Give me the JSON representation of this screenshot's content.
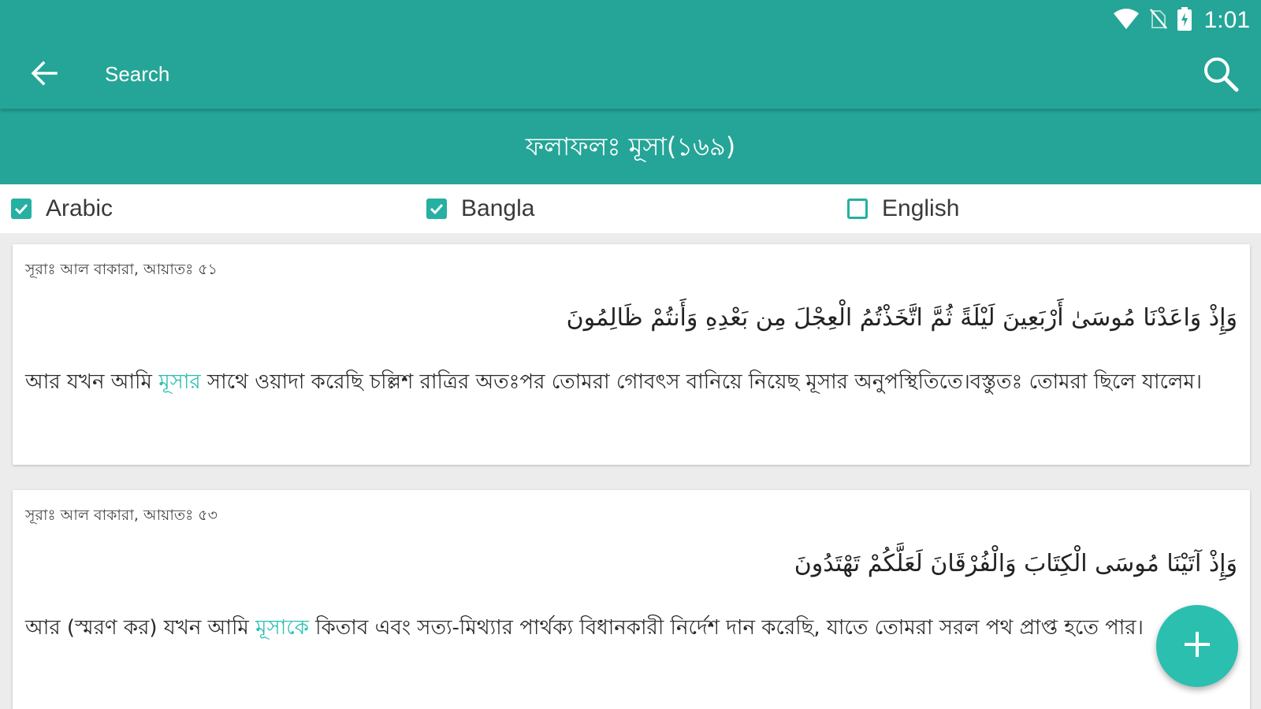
{
  "status_bar": {
    "time": "1:01",
    "icons": [
      "wifi-icon",
      "no-sim-icon",
      "battery-charging-icon"
    ]
  },
  "toolbar": {
    "back_icon": "arrow-left-icon",
    "title": "Search",
    "search_icon": "search-icon"
  },
  "results": {
    "title": "ফলাফলঃ মূসা(১৬৯)"
  },
  "filters": [
    {
      "label": "Arabic",
      "checked": true
    },
    {
      "label": "Bangla",
      "checked": true
    },
    {
      "label": "English",
      "checked": false
    }
  ],
  "cards": [
    {
      "reference": "সূরাঃ আল বাকারা, আয়াতঃ ৫১",
      "arabic": "وَإِذْ وَاعَدْنَا مُوسَىٰ أَرْبَعِينَ لَيْلَةً ثُمَّ اتَّخَذْتُمُ الْعِجْلَ مِن بَعْدِهِ وَأَنتُمْ ظَالِمُونَ",
      "bangla_before": "আর যখন আমি ",
      "bangla_highlight": "মূসার",
      "bangla_after": " সাথে ওয়াদা করেছি চল্লিশ রাত্রির অতঃপর তোমরা গোবৎস বানিয়ে নিয়েছ মূসার অনুপস্থিতিতে।বস্তুতঃ তোমরা ছিলে যালেম।"
    },
    {
      "reference": "সূরাঃ আল বাকারা, আয়াতঃ ৫৩",
      "arabic": "وَإِذْ آتَيْنَا مُوسَى الْكِتَابَ وَالْفُرْقَانَ لَعَلَّكُمْ تَهْتَدُونَ",
      "bangla_before": "আর (স্মরণ কর) যখন আমি ",
      "bangla_highlight": "মূসাকে",
      "bangla_after": " কিতাব এবং সত্য-মিথ্যার পার্থক্য বিধানকারী নির্দেশ দান করেছি, যাতে তোমরা সরল পথ প্রাপ্ত হতে পার।"
    }
  ],
  "fab": {
    "icon": "plus-icon"
  },
  "colors": {
    "primary": "#24a597",
    "accent": "#2bbfb0",
    "background": "#ececec",
    "card": "#ffffff"
  }
}
